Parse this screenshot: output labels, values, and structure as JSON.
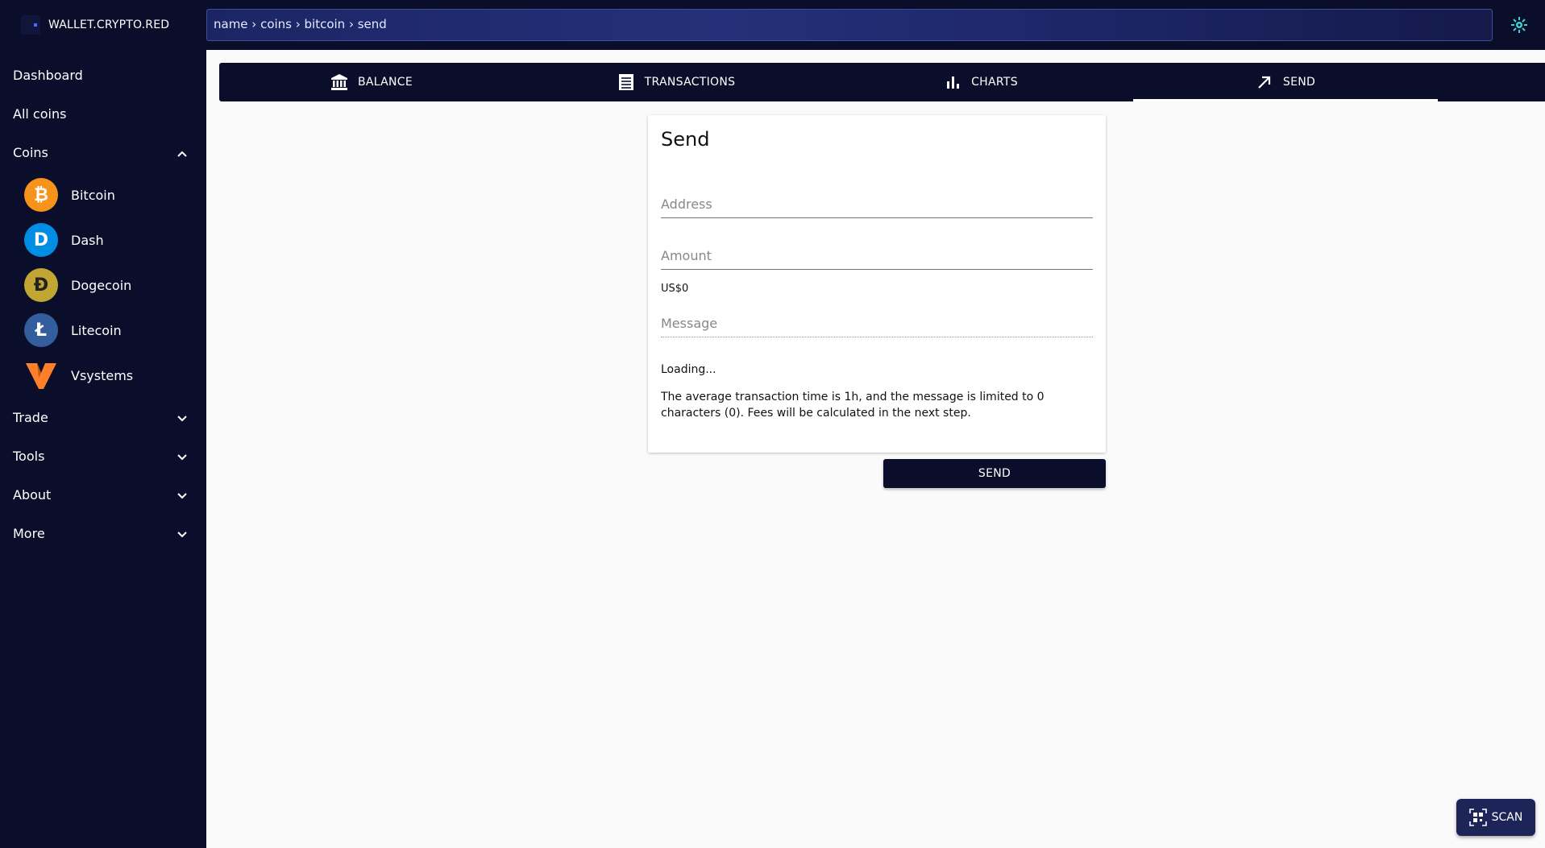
{
  "app": {
    "logo_text": "WALLET.CRYPTO.RED"
  },
  "breadcrumb": "name › coins › bitcoin › send",
  "sidebar": {
    "dashboard": "Dashboard",
    "all_coins": "All coins",
    "coins_label": "Coins",
    "coins": [
      {
        "name": "Bitcoin",
        "symbol": "₿",
        "color": "#f7931a"
      },
      {
        "name": "Dash",
        "symbol": "D",
        "color": "#008de4"
      },
      {
        "name": "Dogecoin",
        "symbol": "Ð",
        "color": "#c2a633"
      },
      {
        "name": "Litecoin",
        "symbol": "Ł",
        "color": "#345d9d"
      },
      {
        "name": "Vsystems",
        "symbol": "V",
        "color": "#ff7f2a"
      }
    ],
    "trade": "Trade",
    "tools": "Tools",
    "about": "About",
    "more": "More"
  },
  "tabs": [
    {
      "label": "BALANCE",
      "icon": "bank-icon"
    },
    {
      "label": "TRANSACTIONS",
      "icon": "list-icon"
    },
    {
      "label": "CHARTS",
      "icon": "bar-chart-icon"
    },
    {
      "label": "SEND",
      "icon": "arrow-up-right-icon",
      "active": true
    }
  ],
  "send": {
    "title": "Send",
    "address_placeholder": "Address",
    "amount_placeholder": "Amount",
    "fiat_value": "US$0",
    "message_placeholder": "Message",
    "loading": "Loading...",
    "info": "The average transaction time is 1h, and the message is limited to 0 characters (0). Fees will be calculated in the next step.",
    "button": "SEND"
  },
  "scan": {
    "label": "SCAN"
  },
  "colors": {
    "navy": "#0b0e2a",
    "accent_cyan": "#3fd1d1"
  }
}
